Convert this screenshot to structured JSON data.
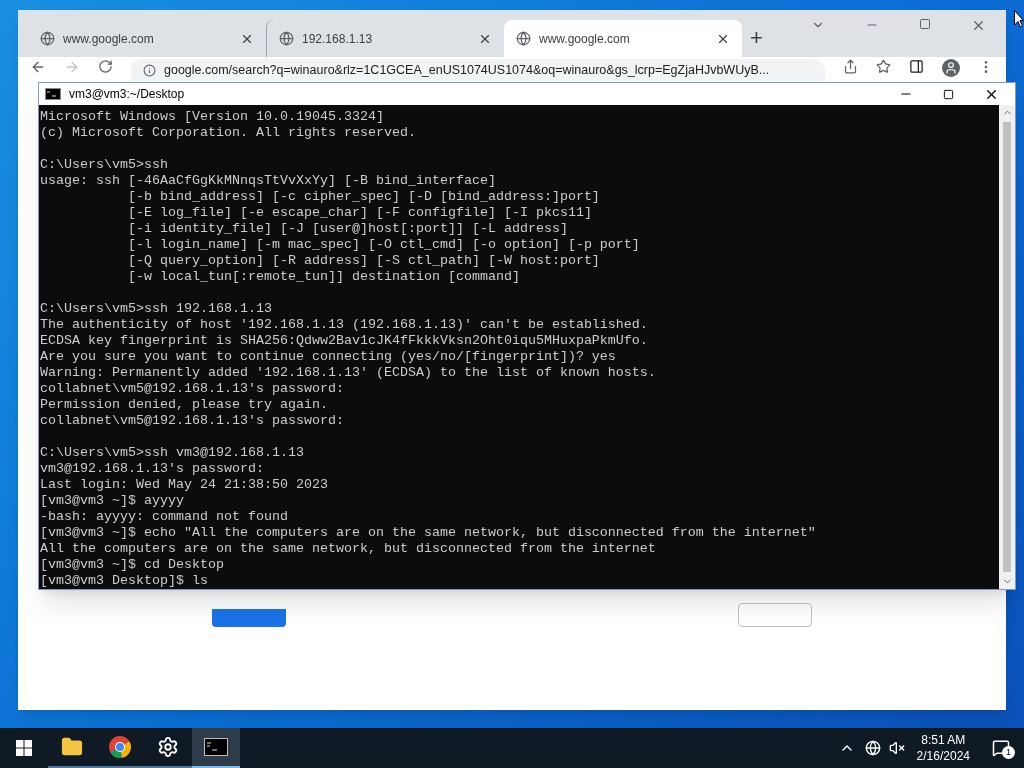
{
  "browser": {
    "tabs": [
      {
        "title": "www.google.com",
        "selected": false
      },
      {
        "title": "192.168.1.13",
        "selected": false
      },
      {
        "title": "www.google.com",
        "selected": true
      }
    ],
    "new_tab": "+",
    "forward_disabled": true,
    "url": "google.com/search?q=winauro&rlz=1C1GCEA_enUS1074US1074&oq=winauro&gs_lcrp=EgZjaHJvbWUyB..."
  },
  "terminal": {
    "title": "vm3@vm3:~/Desktop",
    "blocks": [
      [
        "Microsoft Windows [Version 10.0.19045.3324]",
        "(c) Microsoft Corporation. All rights reserved."
      ],
      [
        "C:\\Users\\vm5>ssh",
        "usage: ssh [-46AaCfGgKkMNnqsTtVvXxYy] [-B bind_interface]",
        "           [-b bind_address] [-c cipher_spec] [-D [bind_address:]port]",
        "           [-E log_file] [-e escape_char] [-F configfile] [-I pkcs11]",
        "           [-i identity_file] [-J [user@]host[:port]] [-L address]",
        "           [-l login_name] [-m mac_spec] [-O ctl_cmd] [-o option] [-p port]",
        "           [-Q query_option] [-R address] [-S ctl_path] [-W host:port]",
        "           [-w local_tun[:remote_tun]] destination [command]"
      ],
      [
        "C:\\Users\\vm5>ssh 192.168.1.13",
        "The authenticity of host '192.168.1.13 (192.168.1.13)' can't be established.",
        "ECDSA key fingerprint is SHA256:Qdww2Bav1cJK4fFkkkVksn2Oht0iqu5MHuxpaPkmUfo.",
        "Are you sure you want to continue connecting (yes/no/[fingerprint])? yes",
        "Warning: Permanently added '192.168.1.13' (ECDSA) to the list of known hosts.",
        "collabnet\\vm5@192.168.1.13's password:",
        "Permission denied, please try again.",
        "collabnet\\vm5@192.168.1.13's password:"
      ],
      [
        "C:\\Users\\vm5>ssh vm3@192.168.1.13",
        "vm3@192.168.1.13's password:",
        "Last login: Wed May 24 21:38:50 2023",
        "[vm3@vm3 ~]$ ayyyy",
        "-bash: ayyyy: command not found",
        "[vm3@vm3 ~]$ echo \"All the computers are on the same network, but disconnected from the internet\"",
        "All the computers are on the same network, but disconnected from the internet",
        "[vm3@vm3 ~]$ cd Desktop",
        "[vm3@vm3 Desktop]$ ls"
      ]
    ]
  },
  "taskbar": {
    "apps": [
      {
        "kind": "folder",
        "selected": false
      },
      {
        "kind": "chrome",
        "selected": false
      },
      {
        "kind": "settings",
        "selected": false
      },
      {
        "kind": "terminal",
        "selected": true
      }
    ],
    "time": "8:51 AM",
    "date": "2/16/2024",
    "notification_count": "1"
  }
}
